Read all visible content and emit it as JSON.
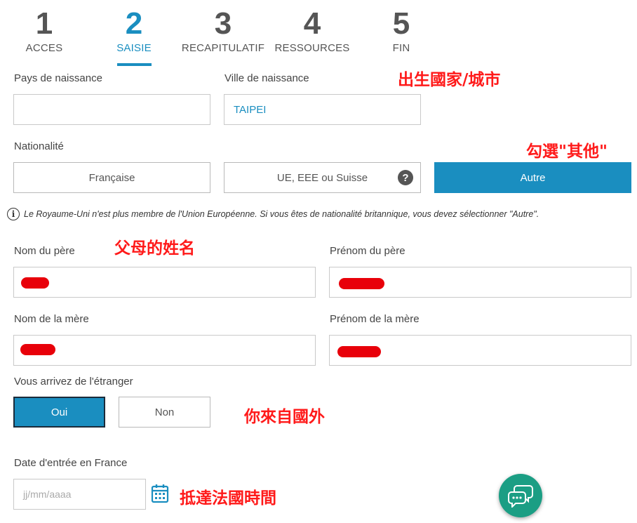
{
  "steps": [
    {
      "num": "1",
      "label": "ACCES"
    },
    {
      "num": "2",
      "label": "SAISIE"
    },
    {
      "num": "3",
      "label": "RECAPITULATIF"
    },
    {
      "num": "4",
      "label": "RESSOURCES"
    },
    {
      "num": "5",
      "label": "FIN"
    }
  ],
  "active_step": "2",
  "birth": {
    "country_label": "Pays de naissance",
    "country_value": "",
    "city_label": "Ville de naissance",
    "city_value": "TAIPEI"
  },
  "nationality": {
    "label": "Nationalité",
    "options": [
      "Française",
      "UE, EEE ou Suisse",
      "Autre"
    ],
    "selected": "Autre",
    "help_glyph": "?"
  },
  "info_note": "Le Royaume-Uni n'est plus membre de l'Union Européenne. Si vous êtes de nationalité britannique, vous devez sélectionner \"Autre\".",
  "info_glyph": "i",
  "parents": {
    "father_last_label": "Nom du père",
    "father_first_label": "Prénom du père",
    "mother_last_label": "Nom de la mère",
    "mother_first_label": "Prénom de la mère"
  },
  "arrival": {
    "label": "Vous arrivez de l'étranger",
    "yes": "Oui",
    "no": "Non",
    "selected": "Oui"
  },
  "entry_date": {
    "label": "Date d'entrée en France",
    "placeholder": "jj/mm/aaaa"
  },
  "annotations": {
    "birth": "出生國家/城市",
    "nationality": "勾選\"其他\"",
    "parents": "父母的姓名",
    "arrival": "你來自國外",
    "entry_date": "抵達法國時間"
  },
  "colors": {
    "accent": "#1a8ec0",
    "annotation": "#ff1a1a",
    "chat": "#1b9e84"
  },
  "icons": {
    "calendar": "calendar-icon",
    "chat": "chat-bubbles-icon",
    "info": "info-icon",
    "help": "question-circle-icon"
  }
}
